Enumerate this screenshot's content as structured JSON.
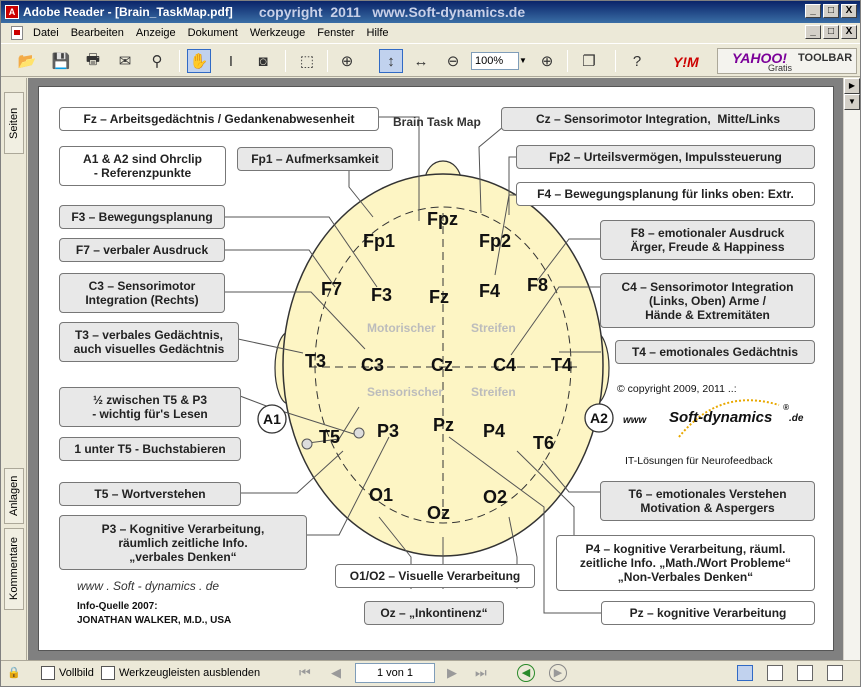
{
  "window": {
    "title": "Adobe Reader - [Brain_TaskMap.pdf]",
    "copyright": "copyright  2011   www.Soft-dynamics.de",
    "buttons": [
      "_",
      "□",
      "X"
    ],
    "mdi_buttons": [
      "_",
      "□",
      "X"
    ]
  },
  "menu": [
    "Datei",
    "Bearbeiten",
    "Anzeige",
    "Dokument",
    "Werkzeuge",
    "Fenster",
    "Hilfe"
  ],
  "toolbar": {
    "zoom_value": "100%",
    "yim": "Y!M",
    "yahoo_brand": "YAHOO!",
    "yahoo_toolbar": "TOOLBAR",
    "yahoo_gratis": "Gratis"
  },
  "side_tabs": {
    "seiten": "Seiten",
    "anlagen": "Anlagen",
    "kommentare": "Kommentare"
  },
  "status": {
    "vollbild": "Vollbild",
    "hide_toolbars": "Werkzeugleisten ausblenden",
    "page_of": "1 von 1"
  },
  "map": {
    "title": "Brain Task Map",
    "electrodes": {
      "fpz": "Fpz",
      "fp1": "Fp1",
      "fp2": "Fp2",
      "f7": "F7",
      "f3": "F3",
      "fz": "Fz",
      "f4": "F4",
      "f8": "F8",
      "t3": "T3",
      "c3": "C3",
      "cz": "Cz",
      "c4": "C4",
      "t4": "T4",
      "t5": "T5",
      "p3": "P3",
      "pz": "Pz",
      "p4": "P4",
      "t6": "T6",
      "o1": "O1",
      "oz": "Oz",
      "o2": "O2",
      "a1": "A1",
      "a2": "A2"
    },
    "motor_strip": {
      "left": "Motorischer",
      "right": "Streifen"
    },
    "sensor_strip": {
      "left": "Sensorischer",
      "right": "Streifen"
    },
    "boxes": {
      "fz": "Fz – Arbeitsgedächtnis / Gedankenabwesenheit",
      "a1a2": "A1 & A2 sind Ohrclip\n- Referenzpunkte",
      "fp1": "Fp1 – Aufmerksamkeit",
      "f3": "F3 – Bewegungsplanung",
      "f7": "F7 – verbaler Ausdruck",
      "c3": "C3 – Sensorimotor\nIntegration (Rechts)",
      "t3": "T3 – verbales Gedächtnis,\nauch visuelles Gedächtnis",
      "halfway": "½ zwischen T5 & P3\n- wichtig für's Lesen",
      "t5under": "1 unter T5 - Buchstabieren",
      "t5": "T5 – Wortverstehen",
      "p3": "P3 – Kognitive Verarbeitung,\nräumlich zeitliche Info.\n„verbales Denken“",
      "cz": "Cz – Sensorimotor Integration,  Mitte/Links",
      "fp2": "Fp2 – Urteilsvermögen, Impulssteuerung",
      "f4": "F4 – Bewegungsplanung für links oben: Extr.",
      "f8": "F8 – emotionaler Ausdruck\nÄrger, Freude & Happiness",
      "c4": "C4 – Sensorimotor Integration\n(Links, Oben) Arme /\nHände & Extremitäten",
      "t4": "T4 – emotionales Gedächtnis",
      "t6": "T6 – emotionales Verstehen\nMotivation & Aspergers",
      "p4": "P4 – kognitive Verarbeitung, räuml.\nzeitliche Info. „Math./Wort Probleme“\n„Non-Verbales Denken“",
      "pz": "Pz – kognitive Verarbeitung",
      "o1o2": "O1/O2 – Visuelle Verarbeitung",
      "oz": "Oz – „Inkontinenz“"
    },
    "copyright": "© copyright 2009, 2011 ..:",
    "brand_www": "www",
    "brand_name": "Soft-dynamics",
    "brand_tld": ".de",
    "brand_reg": "®",
    "it_line": "IT-Lösungen für Neurofeedback",
    "footer_www": "www . Soft - dynamics . de",
    "source_label": "Info-Quelle 2007:",
    "source_author": "JONATHAN WALKER, M.D.,  USA"
  }
}
